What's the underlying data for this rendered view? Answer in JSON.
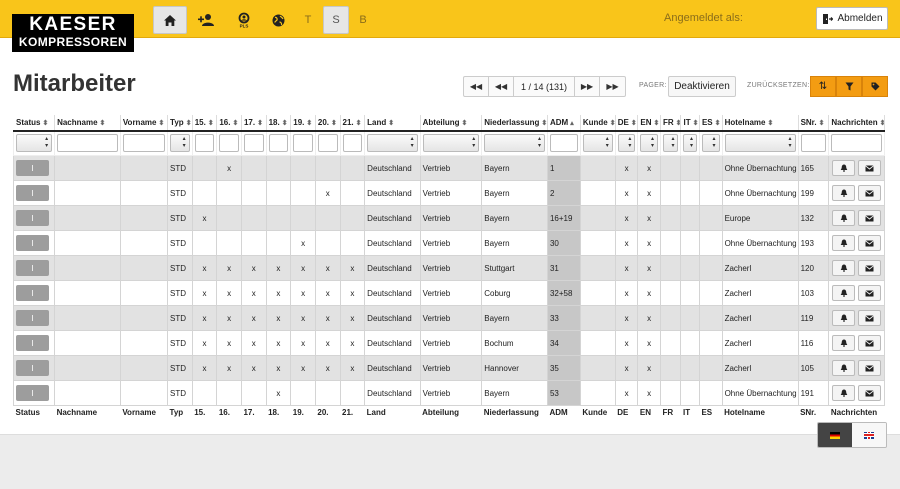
{
  "brand": {
    "line1": "KAESER",
    "line2": "KOMPRESSOREN"
  },
  "nav": {
    "t_label": "T",
    "s_label": "S",
    "b_label": "B"
  },
  "header": {
    "logged_in_label": "Angemeldet als:",
    "logout_label": "Abmelden"
  },
  "page": {
    "title": "Mitarbeiter"
  },
  "pager": {
    "info": "1 / 14 (131)",
    "label": "PAGER:",
    "deactivate_label": "Deaktivieren",
    "reset_label": "ZURÜCKSETZEN:"
  },
  "table": {
    "columns": [
      "Status",
      "Nachname",
      "Vorname",
      "Typ",
      "15.",
      "16.",
      "17.",
      "18.",
      "19.",
      "20.",
      "21.",
      "Land",
      "Abteilung",
      "Niederlassung",
      "ADM",
      "Kunde",
      "DE",
      "EN",
      "FR",
      "IT",
      "ES",
      "Hotelname",
      "SNr.",
      "Nachrichten"
    ],
    "status_label": "I",
    "rows": [
      {
        "typ": "STD",
        "d15": "",
        "d16": "x",
        "d17": "",
        "d18": "",
        "d19": "",
        "d20": "",
        "d21": "",
        "land": "Deutschland",
        "abteilung": "Vertrieb",
        "niederlassung": "Bayern",
        "adm": "1",
        "kunde": "",
        "de": "x",
        "en": "x",
        "fr": "",
        "it": "",
        "es": "",
        "hotel": "Ohne Übernachtung",
        "snr": "165"
      },
      {
        "typ": "STD",
        "d15": "",
        "d16": "",
        "d17": "",
        "d18": "",
        "d19": "",
        "d20": "x",
        "d21": "",
        "land": "Deutschland",
        "abteilung": "Vertrieb",
        "niederlassung": "Bayern",
        "adm": "2",
        "kunde": "",
        "de": "x",
        "en": "x",
        "fr": "",
        "it": "",
        "es": "",
        "hotel": "Ohne Übernachtung",
        "snr": "199"
      },
      {
        "typ": "STD",
        "d15": "x",
        "d16": "",
        "d17": "",
        "d18": "",
        "d19": "",
        "d20": "",
        "d21": "",
        "land": "Deutschland",
        "abteilung": "Vertrieb",
        "niederlassung": "Bayern",
        "adm": "16+19",
        "kunde": "",
        "de": "x",
        "en": "x",
        "fr": "",
        "it": "",
        "es": "",
        "hotel": "Europe",
        "snr": "132"
      },
      {
        "typ": "STD",
        "d15": "",
        "d16": "",
        "d17": "",
        "d18": "",
        "d19": "x",
        "d20": "",
        "d21": "",
        "land": "Deutschland",
        "abteilung": "Vertrieb",
        "niederlassung": "Bayern",
        "adm": "30",
        "kunde": "",
        "de": "x",
        "en": "x",
        "fr": "",
        "it": "",
        "es": "",
        "hotel": "Ohne Übernachtung",
        "snr": "193"
      },
      {
        "typ": "STD",
        "d15": "x",
        "d16": "x",
        "d17": "x",
        "d18": "x",
        "d19": "x",
        "d20": "x",
        "d21": "x",
        "land": "Deutschland",
        "abteilung": "Vertrieb",
        "niederlassung": "Stuttgart",
        "adm": "31",
        "kunde": "",
        "de": "x",
        "en": "x",
        "fr": "",
        "it": "",
        "es": "",
        "hotel": "Zacherl",
        "snr": "120"
      },
      {
        "typ": "STD",
        "d15": "x",
        "d16": "x",
        "d17": "x",
        "d18": "x",
        "d19": "x",
        "d20": "x",
        "d21": "x",
        "land": "Deutschland",
        "abteilung": "Vertrieb",
        "niederlassung": "Coburg",
        "adm": "32+58",
        "kunde": "",
        "de": "x",
        "en": "x",
        "fr": "",
        "it": "",
        "es": "",
        "hotel": "Zacherl",
        "snr": "103"
      },
      {
        "typ": "STD",
        "d15": "x",
        "d16": "x",
        "d17": "x",
        "d18": "x",
        "d19": "x",
        "d20": "x",
        "d21": "x",
        "land": "Deutschland",
        "abteilung": "Vertrieb",
        "niederlassung": "Bayern",
        "adm": "33",
        "kunde": "",
        "de": "x",
        "en": "x",
        "fr": "",
        "it": "",
        "es": "",
        "hotel": "Zacherl",
        "snr": "119"
      },
      {
        "typ": "STD",
        "d15": "x",
        "d16": "x",
        "d17": "x",
        "d18": "x",
        "d19": "x",
        "d20": "x",
        "d21": "x",
        "land": "Deutschland",
        "abteilung": "Vertrieb",
        "niederlassung": "Bochum",
        "adm": "34",
        "kunde": "",
        "de": "x",
        "en": "x",
        "fr": "",
        "it": "",
        "es": "",
        "hotel": "Zacherl",
        "snr": "116"
      },
      {
        "typ": "STD",
        "d15": "x",
        "d16": "x",
        "d17": "x",
        "d18": "x",
        "d19": "x",
        "d20": "x",
        "d21": "x",
        "land": "Deutschland",
        "abteilung": "Vertrieb",
        "niederlassung": "Hannover",
        "adm": "35",
        "kunde": "",
        "de": "x",
        "en": "x",
        "fr": "",
        "it": "",
        "es": "",
        "hotel": "Zacherl",
        "snr": "105"
      },
      {
        "typ": "STD",
        "d15": "",
        "d16": "",
        "d17": "",
        "d18": "x",
        "d19": "",
        "d20": "",
        "d21": "",
        "land": "Deutschland",
        "abteilung": "Vertrieb",
        "niederlassung": "Bayern",
        "adm": "53",
        "kunde": "",
        "de": "x",
        "en": "x",
        "fr": "",
        "it": "",
        "es": "",
        "hotel": "Ohne Übernachtung",
        "snr": "191"
      }
    ]
  },
  "icons": {
    "home": "home-icon",
    "add_user": "add-user-icon",
    "search_person": "search-person-icon",
    "globe": "globe-icon",
    "logout": "logout-icon",
    "first": "first-page-icon",
    "prev": "previous-page-icon",
    "next": "next-page-icon",
    "last": "last-page-icon",
    "reset_sort": "reset-sort-icon",
    "reset_filter": "filter-icon",
    "reset_tag": "tag-icon",
    "bell": "bell-icon",
    "envelope": "envelope-icon",
    "flag_de": "german-flag-icon",
    "flag_en": "uk-flag-icon"
  },
  "colors": {
    "brand_yellow": "#f9c51a",
    "accent_orange": "#f39c12",
    "active_column": "#c7c7c7",
    "status_button": "#9d9d9d"
  },
  "sort": {
    "column": "ADM",
    "direction": "ascending"
  }
}
